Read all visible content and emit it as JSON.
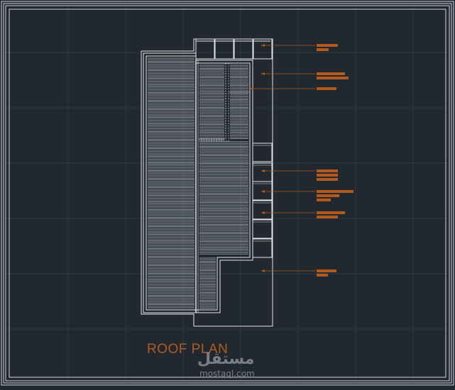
{
  "drawing": {
    "title": "ROOF PLAN",
    "background": "#212830",
    "line_color": "#e6e6e6",
    "annotation_color": "#b35a1f",
    "annotations": [
      {
        "id": "a1",
        "lines": 2
      },
      {
        "id": "a2",
        "lines": 2
      },
      {
        "id": "a3",
        "lines": 1
      },
      {
        "id": "a4",
        "lines": 3
      },
      {
        "id": "a5",
        "lines": 3
      },
      {
        "id": "a6",
        "lines": 2
      },
      {
        "id": "a7",
        "lines": 2
      }
    ]
  },
  "watermark": {
    "arabic": "مستقل",
    "latin": "mostaql.com"
  }
}
